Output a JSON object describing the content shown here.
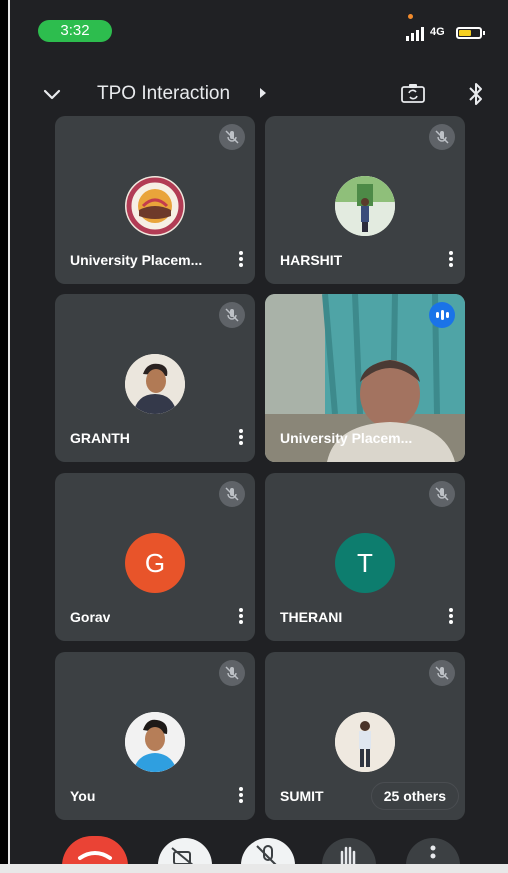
{
  "status_bar": {
    "time": "3:32",
    "network": "4G",
    "battery_level": 0.6,
    "colors": {
      "clock_pill": "#2dbd4e",
      "battery": "#f6d020"
    }
  },
  "header": {
    "title": "TPO Interaction"
  },
  "participants": [
    {
      "name": "University Placem...",
      "muted": true,
      "avatar": "university-logo"
    },
    {
      "name": "HARSHIT",
      "muted": true,
      "avatar": "photo"
    },
    {
      "name": "GRANTH",
      "muted": true,
      "avatar": "photo"
    },
    {
      "name": "University Placem...",
      "muted": false,
      "speaking": true,
      "avatar": "video"
    },
    {
      "name": "Gorav",
      "muted": true,
      "avatar": "letter",
      "letter": "G",
      "color": "#e8542a"
    },
    {
      "name": "THERANI",
      "muted": true,
      "avatar": "letter",
      "letter": "T",
      "color": "#0d7d6e"
    },
    {
      "name": "You",
      "muted": true,
      "avatar": "photo"
    },
    {
      "name": "SUMIT",
      "muted": true,
      "avatar": "photo"
    }
  ],
  "others": {
    "label": "25 others"
  },
  "controls": {
    "end_call_color": "#ea4335",
    "icons": [
      "end-call-icon",
      "camera-off-icon",
      "mic-off-icon",
      "raise-hand-icon",
      "more-options-icon"
    ]
  }
}
